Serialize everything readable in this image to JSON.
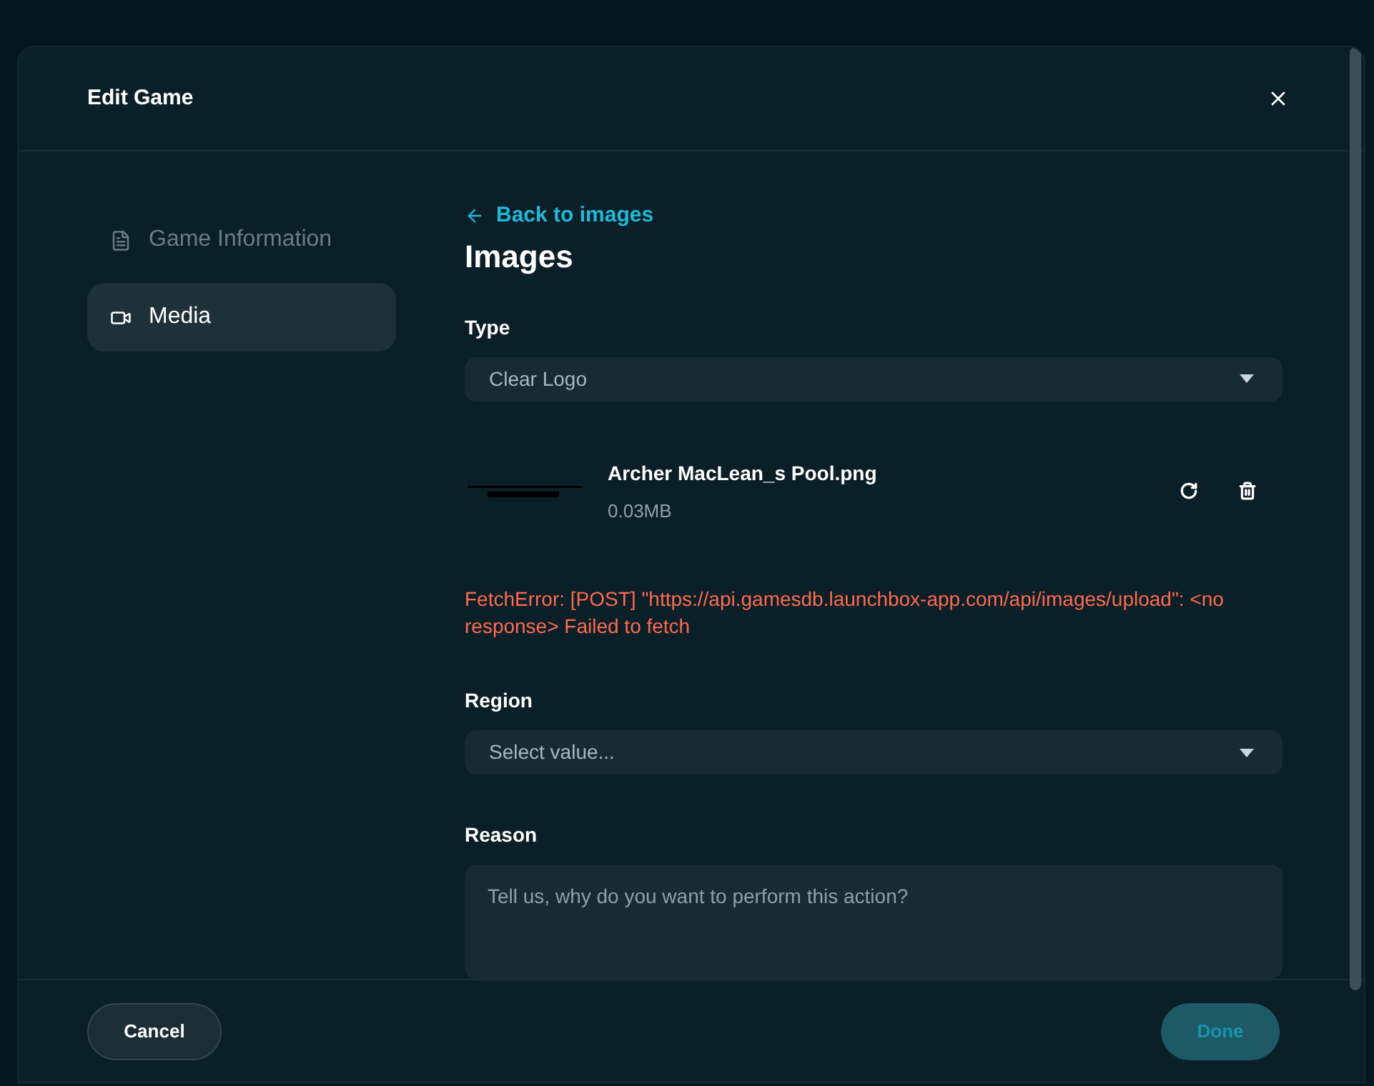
{
  "dialog": {
    "title": "Edit Game"
  },
  "sidebar": {
    "items": [
      {
        "label": "Game Information",
        "selected": false
      },
      {
        "label": "Media",
        "selected": true
      }
    ]
  },
  "content": {
    "back_link": "Back to images",
    "heading": "Images",
    "type_field": {
      "label": "Type",
      "value": "Clear Logo"
    },
    "file": {
      "name": "Archer MacLean_s Pool.png",
      "size": "0.03MB"
    },
    "error": "FetchError: [POST] \"https://api.gamesdb.launchbox-app.com/api/images/upload\": <no response> Failed to fetch",
    "region_field": {
      "label": "Region",
      "placeholder": "Select value..."
    },
    "reason_field": {
      "label": "Reason",
      "placeholder": "Tell us, why do you want to perform this action?"
    }
  },
  "footer": {
    "cancel": "Cancel",
    "done": {
      "label": "Done",
      "disabled": true
    }
  }
}
